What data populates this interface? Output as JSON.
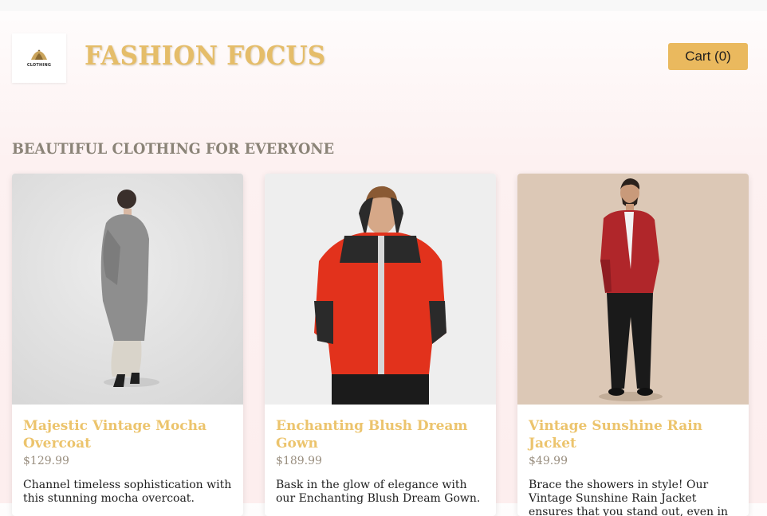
{
  "header": {
    "logo_text": "CLOTHING",
    "brand": "FASHION FOCUS",
    "cart_label": "Cart (0)"
  },
  "section_title": "BEAUTIFUL CLOTHING FOR EVERYONE",
  "products": [
    {
      "name": "Majestic Vintage Mocha Overcoat",
      "price": "$129.99",
      "description": "Channel timeless sophistication with this stunning mocha overcoat."
    },
    {
      "name": "Enchanting Blush Dream Gown",
      "price": "$189.99",
      "description": "Bask in the glow of elegance with our Enchanting Blush Dream Gown."
    },
    {
      "name": "Vintage Sunshine Rain Jacket",
      "price": "$49.99",
      "description": "Brace the showers in style! Our Vintage Sunshine Rain Jacket ensures that you stand out, even in the dullest weather."
    }
  ],
  "colors": {
    "accent": "#eab95e",
    "brand_text": "#e5bd69",
    "product_name": "#ecc46d",
    "section_title": "#8b8478"
  }
}
